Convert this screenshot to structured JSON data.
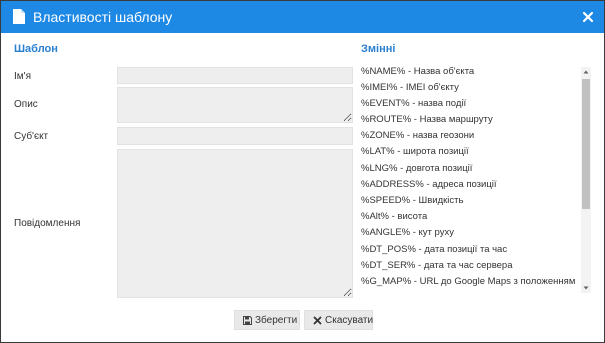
{
  "dialog": {
    "title": "Властивості шаблону",
    "title_icon": "document-icon",
    "close_icon": "close-icon"
  },
  "template_section": {
    "heading": "Шаблон",
    "fields": {
      "name_label": "Ім'я",
      "name_value": "",
      "description_label": "Опис",
      "description_value": "",
      "subject_label": "Суб'єкт",
      "subject_value": "",
      "message_label": "Повідомлення",
      "message_value": ""
    }
  },
  "variables_section": {
    "heading": "Змінні",
    "items": [
      "%NAME% - Назва об'єкта",
      "%IMEI% - IMEI об'єкту",
      "%EVENT% - назва події",
      "%ROUTE% - Назва маршруту",
      "%ZONE% - назва геозони",
      "%LAT% - широта позиції",
      "%LNG% - довгота позиції",
      "%ADDRESS% - адреса позиції",
      "%SPEED% - Швидкість",
      "%Alt% - висота",
      "%ANGLE% - кут руху",
      "%DT_POS% - дата позиції та час",
      "%DT_SER% - дата та час сервера",
      "%G_MAP% - URL до Google Maps з положенням"
    ]
  },
  "buttons": {
    "save_label": "Зберегти",
    "save_icon": "floppy-disk-icon",
    "cancel_label": "Скасувати",
    "cancel_icon": "x-icon"
  },
  "colors": {
    "titlebar": "#1e88e5",
    "section_heading": "#2a7fd1",
    "input_background": "#eeeeee",
    "button_background": "#e9e9e9"
  }
}
